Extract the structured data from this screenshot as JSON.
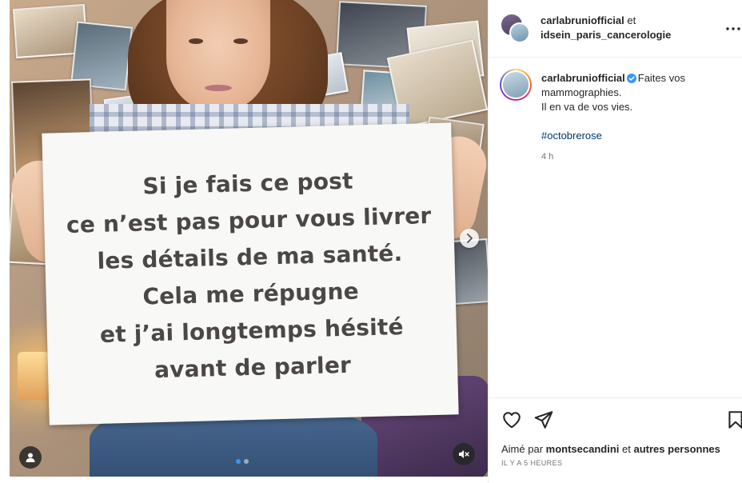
{
  "post": {
    "media": {
      "sign_lines": [
        "Si je fais ce post",
        "ce n’est pas pour vous livrer",
        "les détails de ma santé.",
        "Cela me répugne",
        "et j’ai longtemps hésité",
        "avant de parler"
      ],
      "carousel_position": 1,
      "carousel_total": 2
    },
    "header": {
      "author": "carlabrunio­fficial",
      "connector": "et",
      "collaborator": "idsein_paris_cancerologie"
    },
    "caption": {
      "username": "carlabrunio­fficial",
      "text_line1": "Faites vos mammographies.",
      "text_line2": "Il en va de vos vies.",
      "hashtag": "#octobrerose",
      "time_ago": "4 h"
    },
    "likes": {
      "prefix": "Aimé par",
      "user": "montsecandini",
      "connector": "et",
      "others": "autres personnes"
    },
    "date": "IL Y A 5 HEURES"
  },
  "colors": {
    "verified": "#3897f0",
    "hashtag": "#00376b",
    "carousel_active": "#3897f0"
  },
  "icons": [
    "chevron-right-icon",
    "user-tag-icon",
    "volume-muted-icon",
    "more-icon",
    "verified-badge-icon",
    "heart-icon",
    "share-icon",
    "bookmark-icon"
  ]
}
